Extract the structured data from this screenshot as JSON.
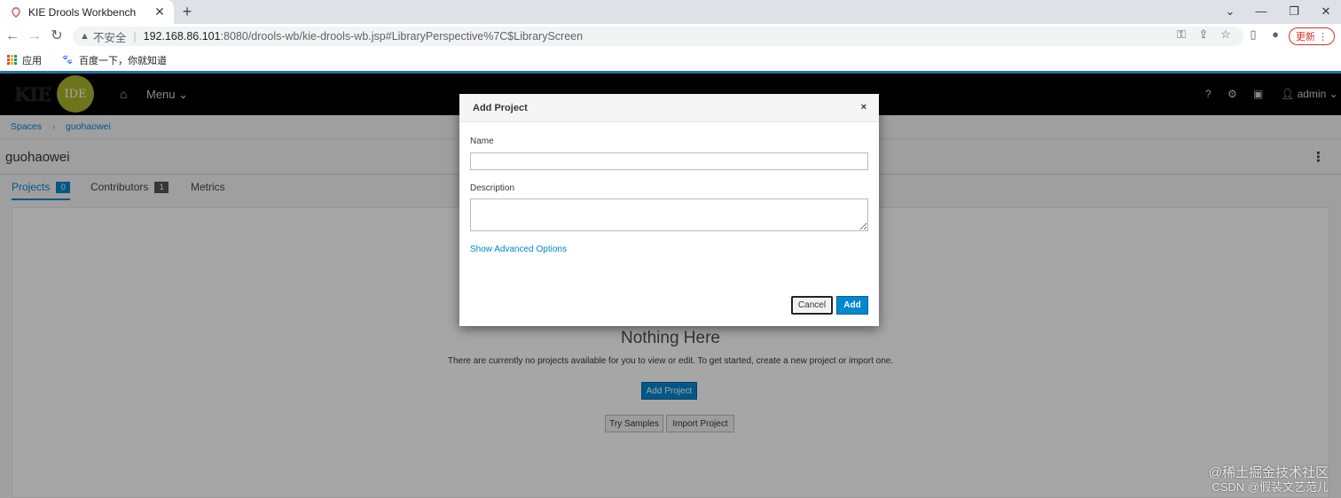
{
  "browser": {
    "tab_title": "KIE Drools Workbench",
    "tab_close": "✕",
    "new_tab": "+",
    "url_insecure_label": "不安全",
    "url_host": "192.168.86.101",
    "url_rest": ":8080/drools-wb/kie-drools-wb.jsp#LibraryPerspective%7C$LibraryScreen",
    "update_label": "更新",
    "bookmarks": [
      {
        "label": "应用"
      },
      {
        "label": "百度一下，你就知道"
      }
    ]
  },
  "navbar": {
    "logo_kie": "KIE",
    "logo_ide": "IDE",
    "menu_label": "Menu",
    "help": "?",
    "user_label": "admin"
  },
  "breadcrumb": {
    "spaces": "Spaces",
    "current": "guohaowei"
  },
  "space": {
    "title": "guohaowei"
  },
  "tabs": [
    {
      "label": "Projects",
      "count": "0"
    },
    {
      "label": "Contributors",
      "count": "1"
    },
    {
      "label": "Metrics"
    }
  ],
  "empty_state": {
    "title": "Nothing Here",
    "description": "There are currently no projects available for you to view or edit. To get started, create a new project or import one.",
    "add_project": "Add Project",
    "try_samples": "Try Samples",
    "import_project": "Import Project"
  },
  "modal": {
    "title": "Add Project",
    "close": "×",
    "name_label": "Name",
    "name_value": "",
    "description_label": "Description",
    "description_value": "",
    "advanced_link": "Show Advanced Options",
    "cancel": "Cancel",
    "add": "Add"
  },
  "watermarks": {
    "line1": "@稀土掘金技术社区",
    "line2": "CSDN @假装文艺范儿"
  },
  "colors": {
    "accent": "#0088ce",
    "navbar": "#000000",
    "logo_circle": "#a9b227"
  }
}
